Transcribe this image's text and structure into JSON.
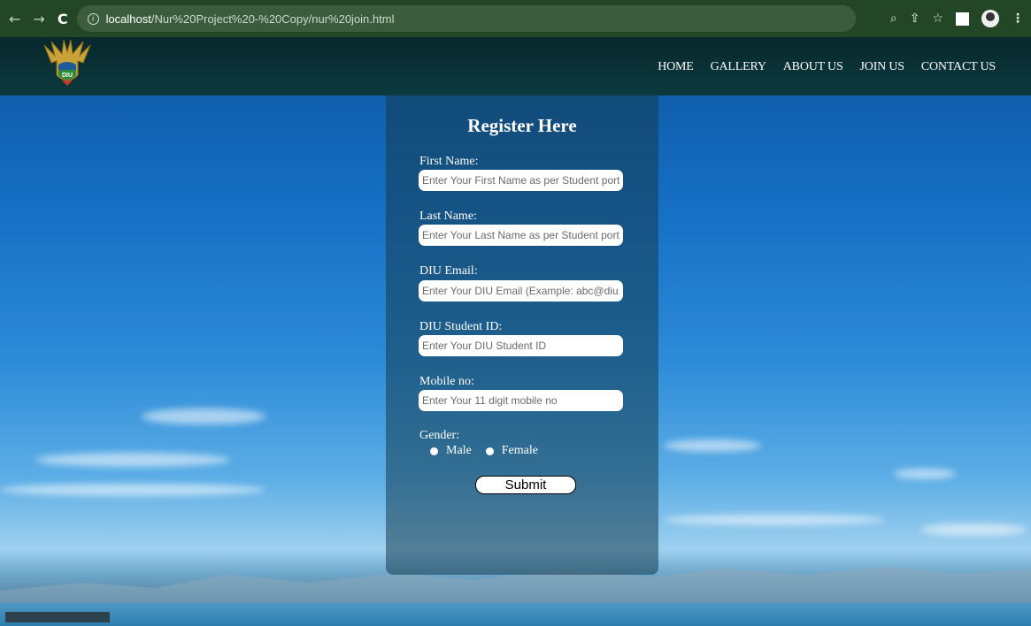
{
  "browser": {
    "url_host": "localhost",
    "url_path": "/Nur%20Project%20-%20Copy/nur%20join.html",
    "nav_back": "←",
    "nav_forward": "→",
    "nav_reload": "C",
    "info_glyph": "i",
    "zoom_glyph": "🔍",
    "share_glyph": "⇪",
    "star_glyph": "☆",
    "menu_glyph": "⋮"
  },
  "site_header": {
    "logo_text": "DIU",
    "nav": [
      "HOME",
      "GALLERY",
      "ABOUT US",
      "JOIN US",
      "CONTACT US"
    ]
  },
  "form": {
    "title": "Register Here",
    "fields": [
      {
        "label": "First Name:",
        "placeholder": "Enter Your First Name as per Student portal"
      },
      {
        "label": "Last Name:",
        "placeholder": "Enter Your Last Name as per Student portal"
      },
      {
        "label": "DIU Email:",
        "placeholder": "Enter Your DIU Email (Example: abc@diu.edu.bd)"
      },
      {
        "label": "DIU Student ID:",
        "placeholder": "Enter Your DIU Student ID"
      },
      {
        "label": "Mobile no:",
        "placeholder": "Enter Your 11 digit mobile no"
      }
    ],
    "gender_label": "Gender:",
    "gender_options": [
      "Male",
      "Female"
    ],
    "submit_label": "Submit"
  },
  "colors": {
    "chrome_bg": "#234626",
    "header_bg": "#0c3a3f",
    "panel_bg": "rgba(20,60,80,0.55)"
  }
}
